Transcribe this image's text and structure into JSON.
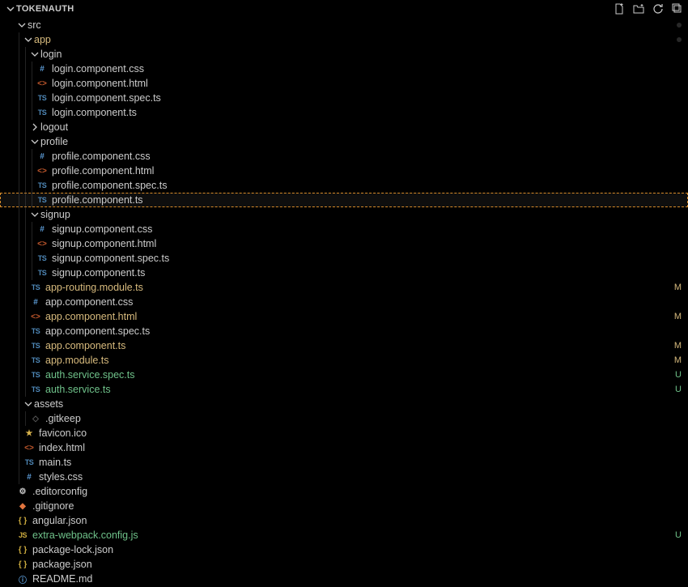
{
  "header": {
    "title": "TOKENAUTH"
  },
  "indentStep": 8,
  "baseIndent": 12,
  "iconGlyphs": {
    "css": "#",
    "html": "<>",
    "ts": "TS",
    "js": "JS",
    "json": "{ }",
    "star": "★",
    "gear": "⚙",
    "info": "ⓘ",
    "git": "◆",
    "none": "◇"
  },
  "rows": [
    {
      "depth": 1,
      "kind": "folder",
      "expanded": true,
      "name": "src",
      "color": "default",
      "dot": true
    },
    {
      "depth": 2,
      "kind": "folder",
      "expanded": true,
      "name": "app",
      "color": "mod",
      "dot": true
    },
    {
      "depth": 3,
      "kind": "folder",
      "expanded": true,
      "name": "login",
      "color": "default"
    },
    {
      "depth": 4,
      "kind": "file",
      "icon": "css",
      "name": "login.component.css",
      "color": "default"
    },
    {
      "depth": 4,
      "kind": "file",
      "icon": "html",
      "name": "login.component.html",
      "color": "default"
    },
    {
      "depth": 4,
      "kind": "file",
      "icon": "ts",
      "name": "login.component.spec.ts",
      "color": "default"
    },
    {
      "depth": 4,
      "kind": "file",
      "icon": "ts",
      "name": "login.component.ts",
      "color": "default"
    },
    {
      "depth": 3,
      "kind": "folder",
      "expanded": false,
      "name": "logout",
      "color": "default"
    },
    {
      "depth": 3,
      "kind": "folder",
      "expanded": true,
      "name": "profile",
      "color": "default"
    },
    {
      "depth": 4,
      "kind": "file",
      "icon": "css",
      "name": "profile.component.css",
      "color": "default"
    },
    {
      "depth": 4,
      "kind": "file",
      "icon": "html",
      "name": "profile.component.html",
      "color": "default"
    },
    {
      "depth": 4,
      "kind": "file",
      "icon": "ts",
      "name": "profile.component.spec.ts",
      "color": "default"
    },
    {
      "depth": 4,
      "kind": "file",
      "icon": "ts",
      "name": "profile.component.ts",
      "color": "default",
      "selected": true
    },
    {
      "depth": 3,
      "kind": "folder",
      "expanded": true,
      "name": "signup",
      "color": "default"
    },
    {
      "depth": 4,
      "kind": "file",
      "icon": "css",
      "name": "signup.component.css",
      "color": "default"
    },
    {
      "depth": 4,
      "kind": "file",
      "icon": "html",
      "name": "signup.component.html",
      "color": "default"
    },
    {
      "depth": 4,
      "kind": "file",
      "icon": "ts",
      "name": "signup.component.spec.ts",
      "color": "default"
    },
    {
      "depth": 4,
      "kind": "file",
      "icon": "ts",
      "name": "signup.component.ts",
      "color": "default"
    },
    {
      "depth": 3,
      "kind": "file",
      "icon": "ts",
      "name": "app-routing.module.ts",
      "color": "mod",
      "badge": "M"
    },
    {
      "depth": 3,
      "kind": "file",
      "icon": "css",
      "name": "app.component.css",
      "color": "default"
    },
    {
      "depth": 3,
      "kind": "file",
      "icon": "html",
      "name": "app.component.html",
      "color": "mod",
      "badge": "M"
    },
    {
      "depth": 3,
      "kind": "file",
      "icon": "ts",
      "name": "app.component.spec.ts",
      "color": "default"
    },
    {
      "depth": 3,
      "kind": "file",
      "icon": "ts",
      "name": "app.component.ts",
      "color": "mod",
      "badge": "M"
    },
    {
      "depth": 3,
      "kind": "file",
      "icon": "ts",
      "name": "app.module.ts",
      "color": "mod",
      "badge": "M"
    },
    {
      "depth": 3,
      "kind": "file",
      "icon": "ts",
      "name": "auth.service.spec.ts",
      "color": "green",
      "badge": "U"
    },
    {
      "depth": 3,
      "kind": "file",
      "icon": "ts",
      "name": "auth.service.ts",
      "color": "green",
      "badge": "U"
    },
    {
      "depth": 2,
      "kind": "folder",
      "expanded": true,
      "name": "assets",
      "color": "default"
    },
    {
      "depth": 3,
      "kind": "file",
      "icon": "none",
      "name": ".gitkeep",
      "color": "default"
    },
    {
      "depth": 2,
      "kind": "file",
      "icon": "star",
      "name": "favicon.ico",
      "color": "default"
    },
    {
      "depth": 2,
      "kind": "file",
      "icon": "html",
      "name": "index.html",
      "color": "default"
    },
    {
      "depth": 2,
      "kind": "file",
      "icon": "ts",
      "name": "main.ts",
      "color": "default"
    },
    {
      "depth": 2,
      "kind": "file",
      "icon": "css",
      "name": "styles.css",
      "color": "default"
    },
    {
      "depth": 1,
      "kind": "file",
      "icon": "gear",
      "name": ".editorconfig",
      "color": "default"
    },
    {
      "depth": 1,
      "kind": "file",
      "icon": "git",
      "name": ".gitignore",
      "color": "default"
    },
    {
      "depth": 1,
      "kind": "file",
      "icon": "json",
      "name": "angular.json",
      "color": "default"
    },
    {
      "depth": 1,
      "kind": "file",
      "icon": "js",
      "name": "extra-webpack.config.js",
      "color": "green",
      "badge": "U"
    },
    {
      "depth": 1,
      "kind": "file",
      "icon": "json",
      "name": "package-lock.json",
      "color": "default"
    },
    {
      "depth": 1,
      "kind": "file",
      "icon": "json",
      "name": "package.json",
      "color": "default"
    },
    {
      "depth": 1,
      "kind": "file",
      "icon": "info",
      "name": "README.md",
      "color": "default"
    }
  ]
}
